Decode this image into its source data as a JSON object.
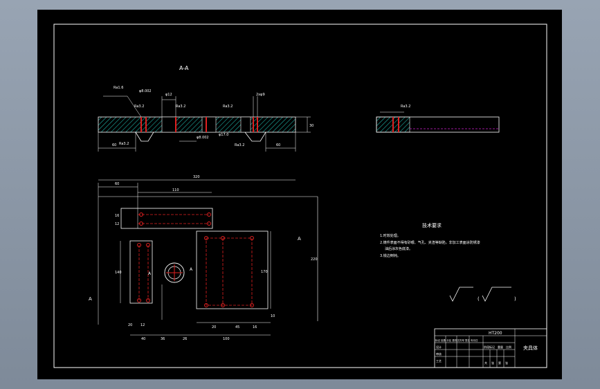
{
  "section_label": "A-A",
  "side_view_label": "A",
  "view_marker_left": "A",
  "view_marker_right": "A",
  "roughness_top": [
    "Ra1.6",
    "Ra3.2",
    "Ra3.2",
    "Ra3.2",
    "Ra3.2"
  ],
  "roughness_bottom": [
    "Ra3.2",
    "Ra3.2",
    "Ra3.2"
  ],
  "roughness_side": "Ra3.2",
  "dims_section": {
    "hole_tol": "φ8.002",
    "hole_a": "φ12",
    "hole_b": "2xφ9",
    "hole_c": "φ8.002",
    "hole_d": "φ17.0",
    "left": "60",
    "right": "60",
    "height": "30"
  },
  "dims_plan": {
    "overall_width": "320",
    "left_offset": "60",
    "slot_length": "110",
    "slot_offset": "20",
    "slot_pitch": "16",
    "slot_width": "12",
    "overall_height": "220",
    "left_slot_h": "140",
    "left_slot_w": "12",
    "left_slot_gap": "20",
    "bottom_a": "40",
    "bottom_b": "36",
    "bottom_c": "26",
    "right_a": "20",
    "right_b": "45",
    "right_c": "16",
    "right_d": "100",
    "right_h": "170",
    "right_gap": "10"
  },
  "tech_req": {
    "title": "技术要求",
    "lines": [
      "1.时效处理。",
      "2.铸件表面不得有砂眼、气孔、夹渣等缺陷，非加工表面涂防锈漆",
      "油后涂灰色底漆。",
      "3.锐边倒钝。"
    ]
  },
  "roughness_note": [
    "(",
    ")"
  ],
  "title_block": {
    "material": "HT200",
    "part_name": "夹具体",
    "rows": [
      "标记 处数 分区 更改文件号 签名 年月日",
      "设计",
      "审核",
      "工艺"
    ],
    "cells": [
      "阶段标记",
      "重量",
      "比例",
      "共",
      "张",
      "第",
      "张"
    ]
  }
}
